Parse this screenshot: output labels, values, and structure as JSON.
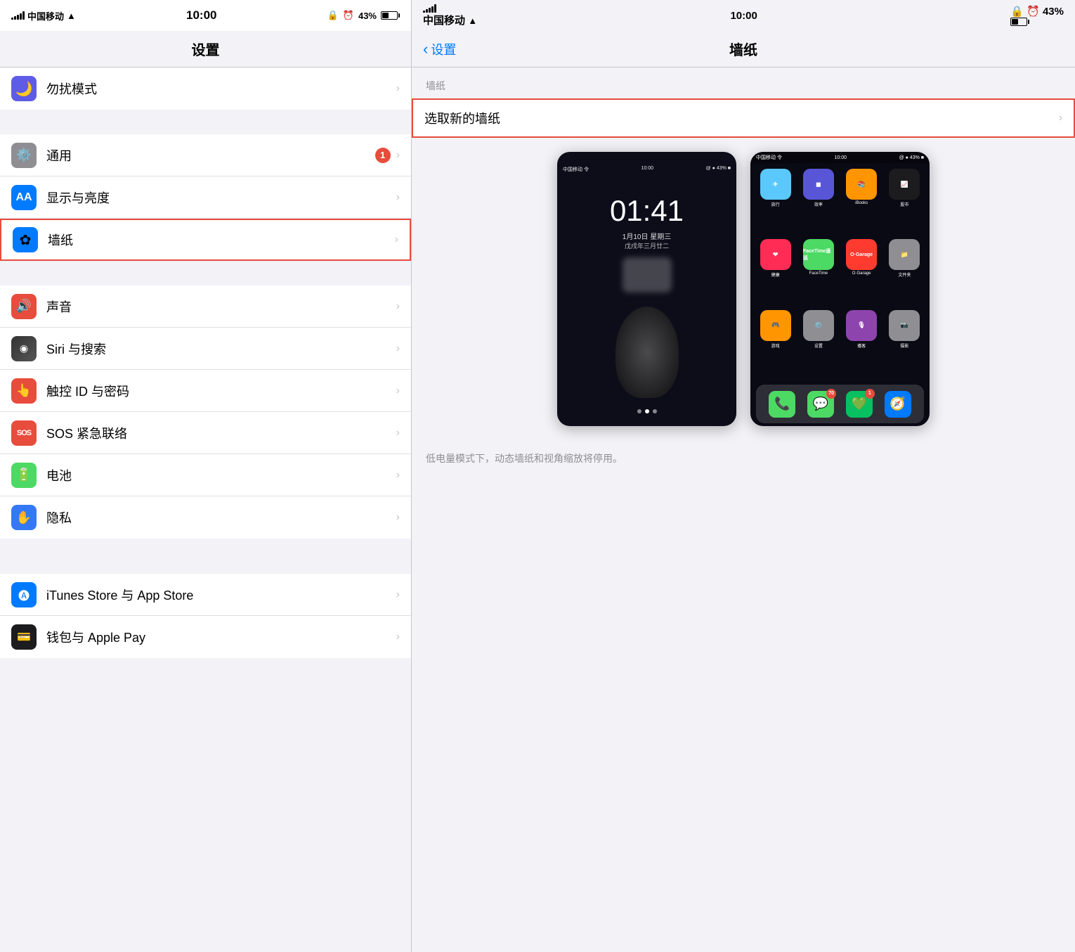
{
  "left": {
    "statusBar": {
      "carrier": "中国移动",
      "time": "10:00",
      "battery": "43%"
    },
    "title": "设置",
    "items": [
      {
        "id": "do-not-disturb",
        "label": "勿扰模式",
        "iconBg": "icon-do-not-disturb",
        "iconEmoji": "🌙",
        "badge": null,
        "highlighted": false
      },
      {
        "id": "general",
        "label": "通用",
        "iconBg": "icon-general",
        "iconEmoji": "⚙️",
        "badge": "1",
        "highlighted": false
      },
      {
        "id": "display",
        "label": "显示与亮度",
        "iconBg": "icon-display",
        "iconEmoji": "AA",
        "badge": null,
        "highlighted": false
      },
      {
        "id": "wallpaper",
        "label": "墙纸",
        "iconBg": "icon-wallpaper",
        "iconEmoji": "✿",
        "badge": null,
        "highlighted": true
      },
      {
        "id": "sounds",
        "label": "声音",
        "iconBg": "icon-sounds",
        "iconEmoji": "🔊",
        "badge": null,
        "highlighted": false
      },
      {
        "id": "siri",
        "label": "Siri 与搜索",
        "iconBg": "icon-siri",
        "iconEmoji": "◉",
        "badge": null,
        "highlighted": false
      },
      {
        "id": "touch-id",
        "label": "触控 ID 与密码",
        "iconBg": "icon-touch-id",
        "iconEmoji": "👆",
        "badge": null,
        "highlighted": false
      },
      {
        "id": "sos",
        "label": "SOS 紧急联络",
        "iconBg": "icon-sos",
        "iconEmoji": "SOS",
        "badge": null,
        "highlighted": false
      },
      {
        "id": "battery",
        "label": "电池",
        "iconBg": "icon-battery",
        "iconEmoji": "🔋",
        "badge": null,
        "highlighted": false
      },
      {
        "id": "privacy",
        "label": "隐私",
        "iconBg": "icon-privacy",
        "iconEmoji": "✋",
        "badge": null,
        "highlighted": false
      }
    ],
    "bottomItems": [
      {
        "id": "itunes",
        "label": "iTunes Store 与 App Store",
        "iconBg": "icon-itunes",
        "iconEmoji": "🅐",
        "badge": null
      },
      {
        "id": "wallet",
        "label": "钱包与 Apple Pay",
        "iconBg": "icon-wallet",
        "iconEmoji": "💳",
        "badge": null
      }
    ]
  },
  "right": {
    "statusBar": {
      "carrier": "中国移动",
      "time": "10:00",
      "battery": "43%"
    },
    "backLabel": "设置",
    "title": "墙纸",
    "sectionLabel": "墙纸",
    "chooseNewLabel": "选取新的墙纸",
    "lockScreenTime": "01:41",
    "lockScreenDate": "1月10日 星期三",
    "lockScreenLunar": "戊戌年三月廿二",
    "homeApps": [
      {
        "label": "旅行",
        "color": "#007aff"
      },
      {
        "label": "效率",
        "color": "#5856d6"
      },
      {
        "label": "iBooks",
        "color": "#ff9500"
      },
      {
        "label": "股市",
        "color": "#1c1c1e"
      },
      {
        "label": "健康",
        "color": "#e74c3c"
      },
      {
        "label": "FaceTime通话",
        "color": "#4cd964"
      },
      {
        "label": "O·Garage",
        "color": "#ff3b30"
      },
      {
        "label": "文件夹",
        "color": "#8e8e93"
      },
      {
        "label": "游戏",
        "color": "#ff9500"
      },
      {
        "label": "设置",
        "color": "#8e8e93"
      },
      {
        "label": "播客",
        "color": "#8e44ad"
      },
      {
        "label": "摄影",
        "color": "#8e8e93"
      }
    ],
    "dockApps": [
      {
        "emoji": "📞",
        "color": "#4cd964",
        "badge": null
      },
      {
        "emoji": "💬",
        "color": "#4cd964",
        "badge": "70"
      },
      {
        "emoji": "💚",
        "color": "#07c160",
        "badge": "1"
      },
      {
        "emoji": "🧭",
        "color": "#007aff",
        "badge": null
      }
    ],
    "noteText": "低电量模式下，动态墙纸和视角缩放将停用。"
  }
}
